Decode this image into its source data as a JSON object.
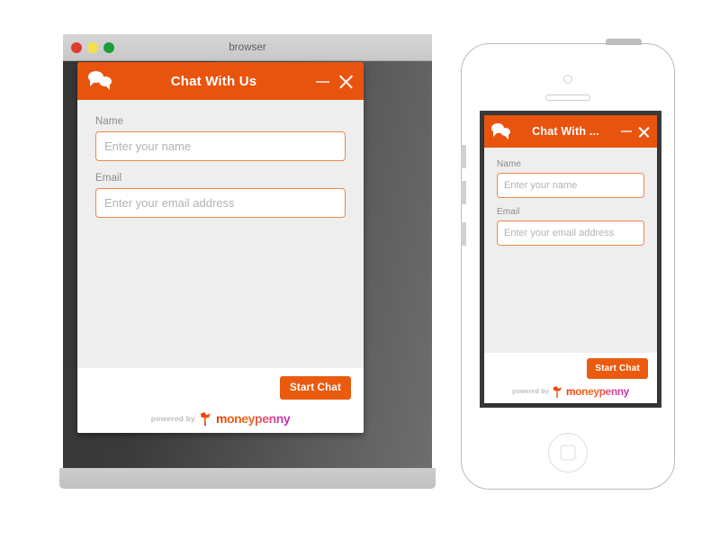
{
  "browser_window": {
    "title": "browser",
    "traffic_lights": [
      {
        "name": "close",
        "color": "#e23b2e"
      },
      {
        "name": "minimize",
        "color": "#f4e04d"
      },
      {
        "name": "zoom",
        "color": "#17a03c"
      }
    ]
  },
  "chat_widget_desktop": {
    "icon": "chat-bubbles-icon",
    "header_title": "Chat With Us",
    "minimize_label": "Minimize",
    "close_label": "Close",
    "fields": [
      {
        "label": "Name",
        "placeholder": "Enter your name",
        "value": ""
      },
      {
        "label": "Email",
        "placeholder": "Enter your email address",
        "value": ""
      }
    ],
    "start_button_label": "Start Chat",
    "branding": {
      "prefix": "powered by",
      "name": "moneypenny"
    },
    "colors": {
      "header": "#e8540e",
      "button": "#ea5b10",
      "input_border": "#f0864a",
      "body": "#eeeeee",
      "footer": "#ffffff"
    }
  },
  "chat_widget_mobile": {
    "icon": "chat-bubbles-icon",
    "header_title": "Chat With ...",
    "minimize_label": "Minimize",
    "close_label": "Close",
    "fields": [
      {
        "label": "Name",
        "placeholder": "Enter your name",
        "value": ""
      },
      {
        "label": "Email",
        "placeholder": "Enter your email address",
        "value": ""
      }
    ],
    "start_button_label": "Start Chat",
    "branding": {
      "prefix": "powered by",
      "name": "moneypenny"
    }
  },
  "phone_mockup": {
    "device": "smartphone",
    "parts": [
      "camera",
      "speaker",
      "home-button",
      "volume-buttons",
      "power-button"
    ]
  }
}
